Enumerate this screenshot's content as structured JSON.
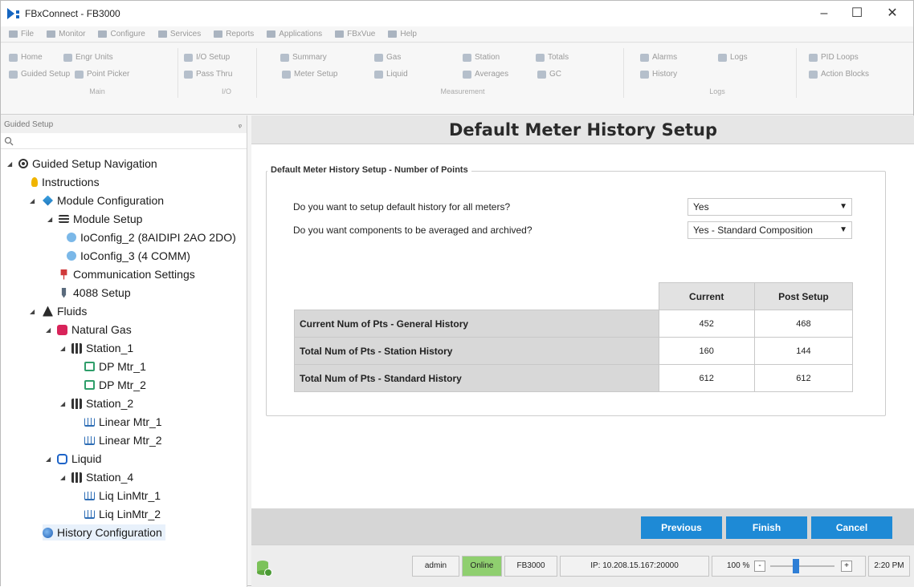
{
  "window": {
    "title": "FBxConnect - FB3000",
    "minimize": "–",
    "maximize": "☐",
    "close": "✕"
  },
  "menu": [
    "File",
    "Monitor",
    "Configure",
    "Services",
    "Reports",
    "Applications",
    "FBxVue",
    "Help"
  ],
  "ribbon": {
    "main": {
      "home": "Home",
      "engr_units": "Engr Units",
      "guided_setup": "Guided Setup",
      "point_picker": "Point Picker",
      "label": "Main"
    },
    "io": {
      "io_setup": "I/O Setup",
      "pass_thru": "Pass Thru",
      "label": "I/O"
    },
    "measurement": {
      "summary": "Summary",
      "gas": "Gas",
      "station": "Station",
      "totals": "Totals",
      "meter_setup": "Meter Setup",
      "liquid": "Liquid",
      "averages": "Averages",
      "gc": "GC",
      "label": "Measurement"
    },
    "logs": {
      "alarms": "Alarms",
      "logs": "Logs",
      "history": "History",
      "label": "Logs"
    },
    "extra": {
      "pid_loops": "PID Loops",
      "action_blocks": "Action Blocks"
    }
  },
  "sidebar": {
    "title": "Guided Setup",
    "pin": "ᵩ",
    "tree": {
      "nav": "Guided Setup Navigation",
      "instructions": "Instructions",
      "module_config": "Module Configuration",
      "module_setup": "Module Setup",
      "ioconfig2": "IoConfig_2 (8AIDIPI 2AO 2DO)",
      "ioconfig3": "IoConfig_3 (4 COMM)",
      "comm_settings": "Communication Settings",
      "setup4088": "4088 Setup",
      "fluids": "Fluids",
      "natural_gas": "Natural Gas",
      "station1": "Station_1",
      "dp1": "DP Mtr_1",
      "dp2": "DP Mtr_2",
      "station2": "Station_2",
      "lin1": "Linear Mtr_1",
      "lin2": "Linear Mtr_2",
      "liquid": "Liquid",
      "station4": "Station_4",
      "liq1": "Liq LinMtr_1",
      "liq2": "Liq LinMtr_2",
      "history_config": "History Configuration"
    }
  },
  "main": {
    "title": "Default Meter History Setup",
    "group_label": "Default Meter History Setup - Number of Points",
    "q1": "Do you want to setup default history for all meters?",
    "q1_value": "Yes",
    "q2": "Do you want components to be averaged and archived?",
    "q2_value": "Yes - Standard Composition",
    "table": {
      "headers": [
        "Current",
        "Post Setup"
      ],
      "rows": [
        {
          "label": "Current Num of Pts - General History",
          "current": "452",
          "post": "468"
        },
        {
          "label": "Total Num of Pts - Station History",
          "current": "160",
          "post": "144"
        },
        {
          "label": "Total Num of Pts - Standard History",
          "current": "612",
          "post": "612"
        }
      ]
    },
    "buttons": {
      "previous": "Previous",
      "finish": "Finish",
      "cancel": "Cancel"
    }
  },
  "status": {
    "user": "admin",
    "state": "Online",
    "device": "FB3000",
    "ip": "IP: 10.208.15.167:20000",
    "zoom": "100 %",
    "zoom_minus": "-",
    "zoom_plus": "+",
    "time": "2:20 PM",
    "zoom_level": 0.4
  },
  "colors": {
    "accent": "#1e8ad6",
    "online": "#8fcf6f"
  }
}
